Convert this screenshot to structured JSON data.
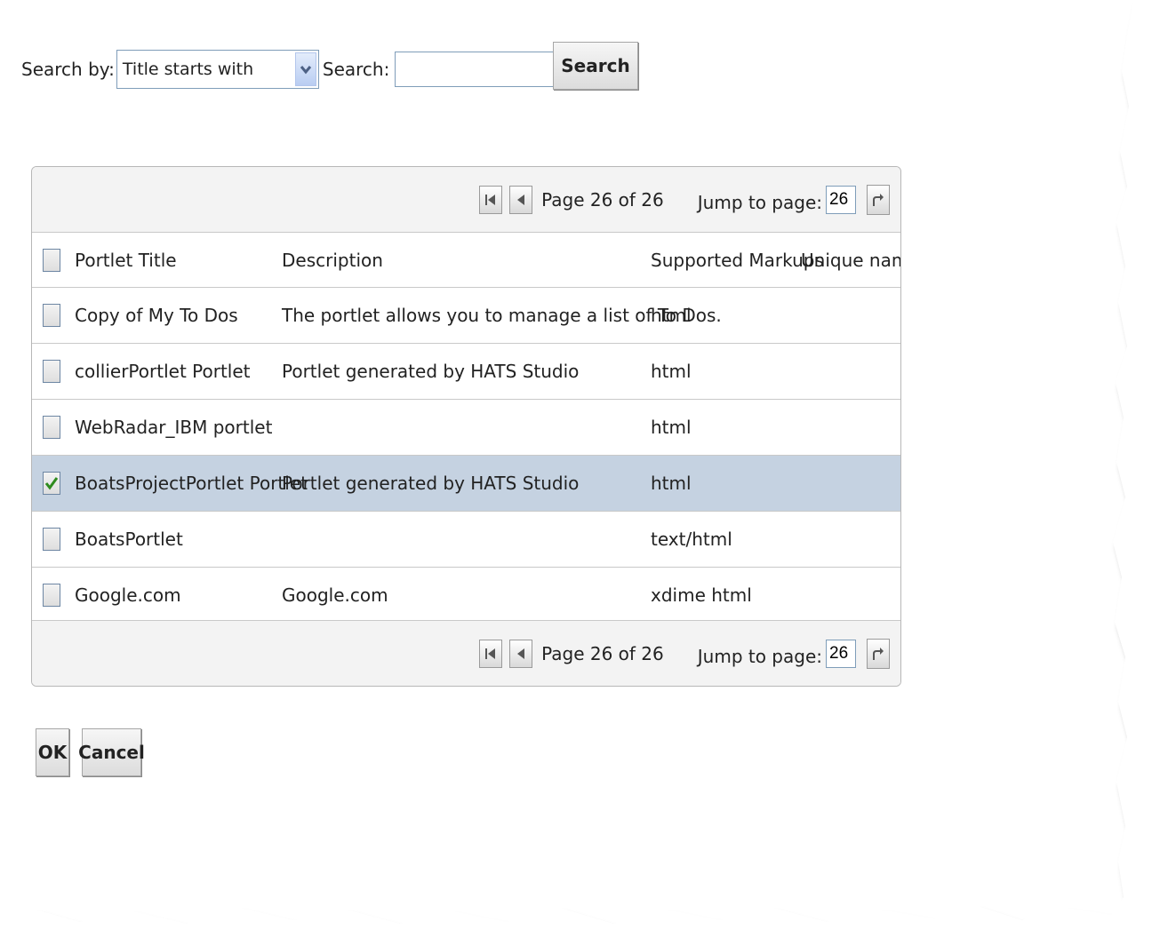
{
  "search": {
    "search_by_label": "Search by:",
    "search_by_value": "Title starts with",
    "search_label": "Search:",
    "search_value": "",
    "search_button": "Search"
  },
  "pager": {
    "page_info": "Page 26 of 26",
    "jump_label": "Jump to page:",
    "jump_value": "26"
  },
  "table": {
    "columns": {
      "title": "Portlet Title",
      "description": "Description",
      "markups": "Supported Markups",
      "unique_name": "Unique name"
    },
    "rows": [
      {
        "title": "Copy of My To Dos",
        "description": "The portlet allows you to manage a list of To Dos.",
        "markups": "html",
        "unique_name": "",
        "checked": false
      },
      {
        "title": "collierPortlet Portlet",
        "description": "Portlet generated by HATS Studio",
        "markups": "html",
        "unique_name": "",
        "checked": false
      },
      {
        "title": "WebRadar_IBM portlet",
        "description": "",
        "markups": "html",
        "unique_name": "",
        "checked": false
      },
      {
        "title": "BoatsProjectPortlet Portlet",
        "description": "Portlet generated by HATS Studio",
        "markups": "html",
        "unique_name": "",
        "checked": true
      },
      {
        "title": "BoatsPortlet",
        "description": "",
        "markups": "text/html",
        "unique_name": "",
        "checked": false
      },
      {
        "title": "Google.com",
        "description": "Google.com",
        "markups": "xdime html",
        "unique_name": "",
        "checked": false
      }
    ]
  },
  "buttons": {
    "ok": "OK",
    "cancel": "Cancel"
  },
  "colors": {
    "selected_row": "#c5d2e1",
    "pager_bg": "#f3f3f3",
    "checkmark": "#2e8b1e"
  }
}
